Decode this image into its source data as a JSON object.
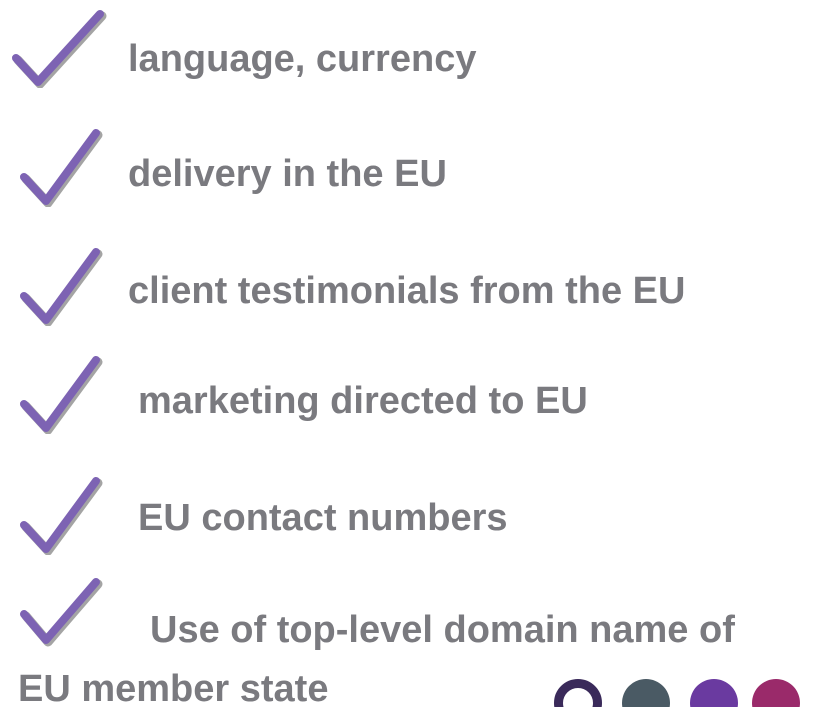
{
  "items": [
    {
      "label": "language, currency"
    },
    {
      "label": "delivery in the EU"
    },
    {
      "label": "client testimonials from the EU"
    },
    {
      "label": "marketing directed to EU"
    },
    {
      "label": "EU contact numbers"
    },
    {
      "label": "Use of top-level domain name of"
    }
  ],
  "continuation": "EU member state",
  "colors": {
    "text": "#7a7a7f",
    "check": "#7d63b3",
    "check_shadow": "#4a4a4a",
    "dots": [
      "#3a2a5a",
      "#4a5a64",
      "#6a3aa0",
      "#9a2a6a"
    ]
  },
  "icons": {
    "check": "checkmark-icon",
    "decoration": "circle-dots"
  }
}
